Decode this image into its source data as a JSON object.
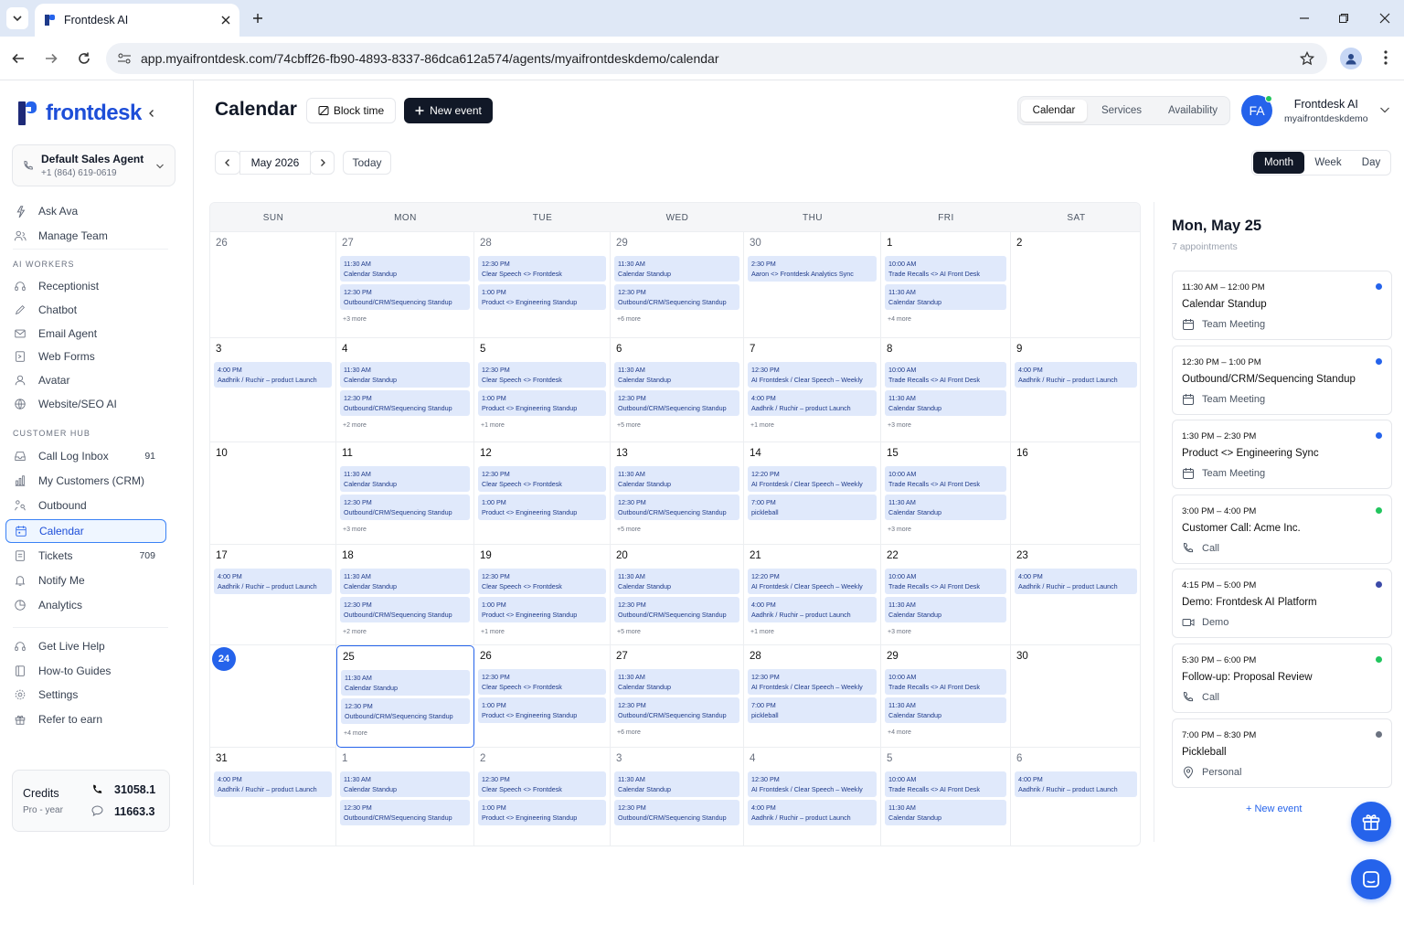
{
  "browser": {
    "tab_title": "Frontdesk AI",
    "url": "app.myaifrontdesk.com/74cbff26-fb90-4893-8337-86dca612a574/agents/myaifrontdeskdemo/calendar"
  },
  "sidebar": {
    "brand": "frontdesk",
    "agent_name": "Default Sales Agent",
    "agent_phone": "+1 (864) 619-0619",
    "top_items": [
      {
        "label": "Ask Ava",
        "icon": "sparkle-icon"
      },
      {
        "label": "Manage Team",
        "icon": "team-icon"
      }
    ],
    "ai_workers_title": "AI WORKERS",
    "ai_workers": [
      {
        "label": "Receptionist",
        "icon": "headset-icon"
      },
      {
        "label": "Chatbot",
        "icon": "pen-icon"
      },
      {
        "label": "Email Agent",
        "icon": "mail-icon"
      },
      {
        "label": "Web Forms",
        "icon": "form-icon"
      },
      {
        "label": "Avatar",
        "icon": "user-icon"
      },
      {
        "label": "Website/SEO AI",
        "icon": "globe-icon"
      }
    ],
    "customer_hub_title": "CUSTOMER HUB",
    "customer_hub": [
      {
        "label": "Call Log Inbox",
        "count": "91",
        "icon": "inbox-icon"
      },
      {
        "label": "My Customers (CRM)",
        "count": "",
        "icon": "bar-chart-icon"
      },
      {
        "label": "Outbound",
        "count": "",
        "icon": "outbound-icon"
      },
      {
        "label": "Calendar",
        "count": "",
        "icon": "calendar-icon",
        "active": true
      },
      {
        "label": "Tickets",
        "count": "709",
        "icon": "ticket-icon"
      },
      {
        "label": "Notify Me",
        "count": "",
        "icon": "bell-icon"
      },
      {
        "label": "Analytics",
        "count": "",
        "icon": "pie-chart-icon"
      }
    ],
    "bottom_items": [
      {
        "label": "Get Live Help",
        "icon": "help-icon"
      },
      {
        "label": "How-to Guides",
        "icon": "book-icon"
      },
      {
        "label": "Settings",
        "icon": "gear-icon"
      },
      {
        "label": "Refer to earn",
        "icon": "gift-icon"
      }
    ],
    "credits": {
      "title": "Credits",
      "plan": "Pro - year",
      "voice": "31058.1",
      "chat": "11663.3"
    }
  },
  "header": {
    "title": "Calendar",
    "block_time": "Block time",
    "new_event": "New event",
    "tabs": [
      "Calendar",
      "Services",
      "Availability"
    ],
    "user_initials": "FA",
    "user_name": "Frontdesk AI",
    "user_handle": "myaifrontdeskdemo"
  },
  "toolbar": {
    "month_label": "May 2026",
    "today": "Today",
    "views": [
      "Month",
      "Week",
      "Day"
    ],
    "active_view": "Month"
  },
  "calendar": {
    "weekdays": [
      "SUN",
      "MON",
      "TUE",
      "WED",
      "THU",
      "FRI",
      "SAT"
    ],
    "weeks": [
      [
        {
          "d": "26",
          "out": true,
          "events": [],
          "more": ""
        },
        {
          "d": "27",
          "out": true,
          "events": [
            {
              "t": "11:30 AM",
              "n": "Calendar Standup"
            },
            {
              "t": "12:30 PM",
              "n": "Outbound/CRM/Sequencing Standup"
            }
          ],
          "more": "+3 more"
        },
        {
          "d": "28",
          "out": true,
          "events": [
            {
              "t": "12:30 PM",
              "n": "Clear Speech <> Frontdesk"
            },
            {
              "t": "1:00 PM",
              "n": "Product <> Engineering Standup"
            }
          ],
          "more": ""
        },
        {
          "d": "29",
          "out": true,
          "events": [
            {
              "t": "11:30 AM",
              "n": "Calendar Standup"
            },
            {
              "t": "12:30 PM",
              "n": "Outbound/CRM/Sequencing Standup"
            }
          ],
          "more": "+6 more"
        },
        {
          "d": "30",
          "out": true,
          "events": [
            {
              "t": "2:30 PM",
              "n": "Aaron <> Frontdesk Analytics Sync"
            }
          ],
          "more": ""
        },
        {
          "d": "1",
          "out": false,
          "events": [
            {
              "t": "10:00 AM",
              "n": "Trade Recalls <> AI Front Desk"
            },
            {
              "t": "11:30 AM",
              "n": "Calendar Standup"
            }
          ],
          "more": "+4 more"
        },
        {
          "d": "2",
          "out": false,
          "events": [],
          "more": ""
        }
      ],
      [
        {
          "d": "3",
          "out": false,
          "events": [
            {
              "t": "4:00 PM",
              "n": "Aadhrik / Ruchir – product Launch"
            }
          ],
          "more": ""
        },
        {
          "d": "4",
          "out": false,
          "events": [
            {
              "t": "11:30 AM",
              "n": "Calendar Standup"
            },
            {
              "t": "12:30 PM",
              "n": "Outbound/CRM/Sequencing Standup"
            }
          ],
          "more": "+2 more"
        },
        {
          "d": "5",
          "out": false,
          "events": [
            {
              "t": "12:30 PM",
              "n": "Clear Speech <> Frontdesk"
            },
            {
              "t": "1:00 PM",
              "n": "Product <> Engineering Standup"
            }
          ],
          "more": "+1 more"
        },
        {
          "d": "6",
          "out": false,
          "events": [
            {
              "t": "11:30 AM",
              "n": "Calendar Standup"
            },
            {
              "t": "12:30 PM",
              "n": "Outbound/CRM/Sequencing Standup"
            }
          ],
          "more": "+5 more"
        },
        {
          "d": "7",
          "out": false,
          "events": [
            {
              "t": "12:30 PM",
              "n": "AI Frontdesk / Clear Speech – Weekly"
            },
            {
              "t": "4:00 PM",
              "n": "Aadhrik / Ruchir – product Launch"
            }
          ],
          "more": "+1 more"
        },
        {
          "d": "8",
          "out": false,
          "events": [
            {
              "t": "10:00 AM",
              "n": "Trade Recalls <> AI Front Desk"
            },
            {
              "t": "11:30 AM",
              "n": "Calendar Standup"
            }
          ],
          "more": "+3 more"
        },
        {
          "d": "9",
          "out": false,
          "events": [
            {
              "t": "4:00 PM",
              "n": "Aadhrik / Ruchir – product Launch"
            }
          ],
          "more": ""
        }
      ],
      [
        {
          "d": "10",
          "out": false,
          "events": [],
          "more": ""
        },
        {
          "d": "11",
          "out": false,
          "events": [
            {
              "t": "11:30 AM",
              "n": "Calendar Standup"
            },
            {
              "t": "12:30 PM",
              "n": "Outbound/CRM/Sequencing Standup"
            }
          ],
          "more": "+3 more"
        },
        {
          "d": "12",
          "out": false,
          "events": [
            {
              "t": "12:30 PM",
              "n": "Clear Speech <> Frontdesk"
            },
            {
              "t": "1:00 PM",
              "n": "Product <> Engineering Standup"
            }
          ],
          "more": ""
        },
        {
          "d": "13",
          "out": false,
          "events": [
            {
              "t": "11:30 AM",
              "n": "Calendar Standup"
            },
            {
              "t": "12:30 PM",
              "n": "Outbound/CRM/Sequencing Standup"
            }
          ],
          "more": "+5 more"
        },
        {
          "d": "14",
          "out": false,
          "events": [
            {
              "t": "12:20 PM",
              "n": "AI Frontdesk / Clear Speech – Weekly"
            },
            {
              "t": "7:00 PM",
              "n": "pickleball"
            }
          ],
          "more": ""
        },
        {
          "d": "15",
          "out": false,
          "events": [
            {
              "t": "10:00 AM",
              "n": "Trade Recalls <> AI Front Desk"
            },
            {
              "t": "11:30 AM",
              "n": "Calendar Standup"
            }
          ],
          "more": "+3 more"
        },
        {
          "d": "16",
          "out": false,
          "events": [],
          "more": ""
        }
      ],
      [
        {
          "d": "17",
          "out": false,
          "events": [
            {
              "t": "4:00 PM",
              "n": "Aadhrik / Ruchir – product Launch"
            }
          ],
          "more": ""
        },
        {
          "d": "18",
          "out": false,
          "events": [
            {
              "t": "11:30 AM",
              "n": "Calendar Standup"
            },
            {
              "t": "12:30 PM",
              "n": "Outbound/CRM/Sequencing Standup"
            }
          ],
          "more": "+2 more"
        },
        {
          "d": "19",
          "out": false,
          "events": [
            {
              "t": "12:30 PM",
              "n": "Clear Speech <> Frontdesk"
            },
            {
              "t": "1:00 PM",
              "n": "Product <> Engineering Standup"
            }
          ],
          "more": "+1 more"
        },
        {
          "d": "20",
          "out": false,
          "events": [
            {
              "t": "11:30 AM",
              "n": "Calendar Standup"
            },
            {
              "t": "12:30 PM",
              "n": "Outbound/CRM/Sequencing Standup"
            }
          ],
          "more": "+5 more"
        },
        {
          "d": "21",
          "out": false,
          "events": [
            {
              "t": "12:20 PM",
              "n": "AI Frontdesk / Clear Speech – Weekly"
            },
            {
              "t": "4:00 PM",
              "n": "Aadhrik / Ruchir – product Launch"
            }
          ],
          "more": "+1 more"
        },
        {
          "d": "22",
          "out": false,
          "events": [
            {
              "t": "10:00 AM",
              "n": "Trade Recalls <> AI Front Desk"
            },
            {
              "t": "11:30 AM",
              "n": "Calendar Standup"
            }
          ],
          "more": "+3 more"
        },
        {
          "d": "23",
          "out": false,
          "events": [
            {
              "t": "4:00 PM",
              "n": "Aadhrik / Ruchir – product Launch"
            }
          ],
          "more": ""
        }
      ],
      [
        {
          "d": "24",
          "out": false,
          "today": true,
          "events": [],
          "more": ""
        },
        {
          "d": "25",
          "out": false,
          "selected": true,
          "events": [
            {
              "t": "11:30 AM",
              "n": "Calendar Standup"
            },
            {
              "t": "12:30 PM",
              "n": "Outbound/CRM/Sequencing Standup"
            }
          ],
          "more": "+4 more"
        },
        {
          "d": "26",
          "out": false,
          "events": [
            {
              "t": "12:30 PM",
              "n": "Clear Speech <> Frontdesk"
            },
            {
              "t": "1:00 PM",
              "n": "Product <> Engineering Standup"
            }
          ],
          "more": ""
        },
        {
          "d": "27",
          "out": false,
          "events": [
            {
              "t": "11:30 AM",
              "n": "Calendar Standup"
            },
            {
              "t": "12:30 PM",
              "n": "Outbound/CRM/Sequencing Standup"
            }
          ],
          "more": "+6 more"
        },
        {
          "d": "28",
          "out": false,
          "events": [
            {
              "t": "12:30 PM",
              "n": "AI Frontdesk / Clear Speech – Weekly"
            },
            {
              "t": "7:00 PM",
              "n": "pickleball"
            }
          ],
          "more": ""
        },
        {
          "d": "29",
          "out": false,
          "events": [
            {
              "t": "10:00 AM",
              "n": "Trade Recalls <> AI Front Desk"
            },
            {
              "t": "11:30 AM",
              "n": "Calendar Standup"
            }
          ],
          "more": "+4 more"
        },
        {
          "d": "30",
          "out": false,
          "events": [],
          "more": ""
        }
      ],
      [
        {
          "d": "31",
          "out": false,
          "events": [
            {
              "t": "4:00 PM",
              "n": "Aadhrik / Ruchir – product Launch"
            }
          ],
          "more": ""
        },
        {
          "d": "1",
          "out": true,
          "events": [
            {
              "t": "11:30 AM",
              "n": "Calendar Standup"
            },
            {
              "t": "12:30 PM",
              "n": "Outbound/CRM/Sequencing Standup"
            }
          ],
          "more": ""
        },
        {
          "d": "2",
          "out": true,
          "events": [
            {
              "t": "12:30 PM",
              "n": "Clear Speech <> Frontdesk"
            },
            {
              "t": "1:00 PM",
              "n": "Product <> Engineering Standup"
            }
          ],
          "more": ""
        },
        {
          "d": "3",
          "out": true,
          "events": [
            {
              "t": "11:30 AM",
              "n": "Calendar Standup"
            },
            {
              "t": "12:30 PM",
              "n": "Outbound/CRM/Sequencing Standup"
            }
          ],
          "more": ""
        },
        {
          "d": "4",
          "out": true,
          "events": [
            {
              "t": "12:30 PM",
              "n": "AI Frontdesk / Clear Speech – Weekly"
            },
            {
              "t": "4:00 PM",
              "n": "Aadhrik / Ruchir – product Launch"
            }
          ],
          "more": ""
        },
        {
          "d": "5",
          "out": true,
          "events": [
            {
              "t": "10:00 AM",
              "n": "Trade Recalls <> AI Front Desk"
            },
            {
              "t": "11:30 AM",
              "n": "Calendar Standup"
            }
          ],
          "more": ""
        },
        {
          "d": "6",
          "out": true,
          "events": [
            {
              "t": "4:00 PM",
              "n": "Aadhrik / Ruchir – product Launch"
            }
          ],
          "more": ""
        }
      ]
    ]
  },
  "day_panel": {
    "title": "Mon, May 25",
    "subtitle": "7 appointments",
    "appointments": [
      {
        "time": "11:30 AM  –  12:00 PM",
        "name": "Calendar Standup",
        "type": "Team Meeting",
        "type_icon": "calendar-small-icon",
        "status_color": "#2563eb"
      },
      {
        "time": "12:30 PM  –  1:00 PM",
        "name": "Outbound/CRM/Sequencing Standup",
        "type": "Team Meeting",
        "type_icon": "calendar-small-icon",
        "status_color": "#2563eb"
      },
      {
        "time": "1:30 PM  –  2:30 PM",
        "name": "Product <> Engineering Sync",
        "type": "Team Meeting",
        "type_icon": "calendar-small-icon",
        "status_color": "#2563eb"
      },
      {
        "time": "3:00 PM  –  4:00 PM",
        "name": "Customer Call: Acme Inc.",
        "type": "Call",
        "type_icon": "phone-icon",
        "status_color": "#22c55e"
      },
      {
        "time": "4:15 PM  –  5:00 PM",
        "name": "Demo: Frontdesk AI Platform",
        "type": "Demo",
        "type_icon": "video-icon",
        "status_color": "#3b4aa8"
      },
      {
        "time": "5:30 PM  –  6:00 PM",
        "name": "Follow-up: Proposal Review",
        "type": "Call",
        "type_icon": "phone-icon",
        "status_color": "#22c55e"
      },
      {
        "time": "7:00 PM  –  8:30 PM",
        "name": "Pickleball",
        "type": "Personal",
        "type_icon": "pin-icon",
        "status_color": "#6b7280"
      }
    ],
    "new_event": "+ New event"
  },
  "colors": {
    "accent": "#2563eb",
    "event_bg": "#e0e9fb",
    "dark_button": "#111827"
  }
}
